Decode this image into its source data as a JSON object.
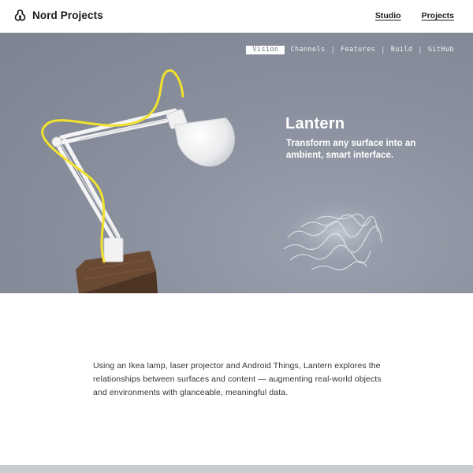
{
  "header": {
    "brand": "Nord Projects",
    "nav": [
      {
        "label": "Studio"
      },
      {
        "label": "Projects"
      }
    ]
  },
  "subnav": {
    "items": [
      "Vision",
      "Channels",
      "Features",
      "Build",
      "GitHub"
    ],
    "active": "Vision"
  },
  "hero": {
    "title": "Lantern",
    "subtitle": "Transform any surface into an ambient, smart interface."
  },
  "intro": "Using an Ikea lamp, laser projector and Android Things, Lantern explores the relationships between surfaces and content — augmenting real-world objects and environments with glanceable, meaningful data.",
  "colors": {
    "hero_bg": "#8a909d",
    "cable": "#f1e22e",
    "lamp": "#f4f4f4",
    "wood": "#6b4a34"
  },
  "icons": {
    "brand": "nord-projects-logo-icon"
  }
}
